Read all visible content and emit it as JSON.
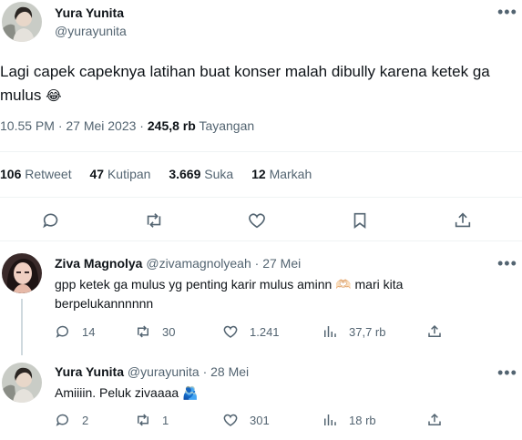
{
  "main_tweet": {
    "author_name": "Yura Yunita",
    "author_handle": "@yurayunita",
    "text": "Lagi capek capeknya latihan buat konser malah dibully karena ketek ga mulus",
    "emoji": "😂",
    "time": "10.55 PM · 27 Mei 2023 · ",
    "views_count": "245,8 rb",
    "views_label": "Tayangan",
    "stats": {
      "retweets": "106",
      "retweets_label": "Retweet",
      "quotes": "47",
      "quotes_label": "Kutipan",
      "likes": "3.669",
      "likes_label": "Suka",
      "bookmarks": "12",
      "bookmarks_label": "Markah"
    },
    "actions": [
      "reply-icon",
      "retweet-icon",
      "like-icon",
      "bookmark-icon",
      "share-icon"
    ]
  },
  "replies": [
    {
      "author_name": "Ziva Magnolya",
      "author_handle": "@zivamagnolyeah",
      "date": "· 27 Mei",
      "text_line1": "gpp ketek ga mulus yg penting karir mulus aminn",
      "emoji": "🫶🏻",
      "text_line1_end": "mari kita",
      "text_line2": "berpelukannnnnn",
      "counts": {
        "replies": "14",
        "retweets": "30",
        "likes": "1.241",
        "views": "37,7 rb"
      }
    },
    {
      "author_name": "Yura Yunita",
      "author_handle": "@yurayunita",
      "date": "· 28 Mei",
      "text": "Amiiiin. Peluk zivaaaa",
      "emoji": "🫂",
      "counts": {
        "replies": "2",
        "retweets": "1",
        "likes": "301",
        "views": "18 rb"
      }
    }
  ],
  "colors": {
    "text": "#0f1419",
    "muted": "#536471",
    "divider": "#eff3f4",
    "thread_line": "#cfd9de"
  }
}
